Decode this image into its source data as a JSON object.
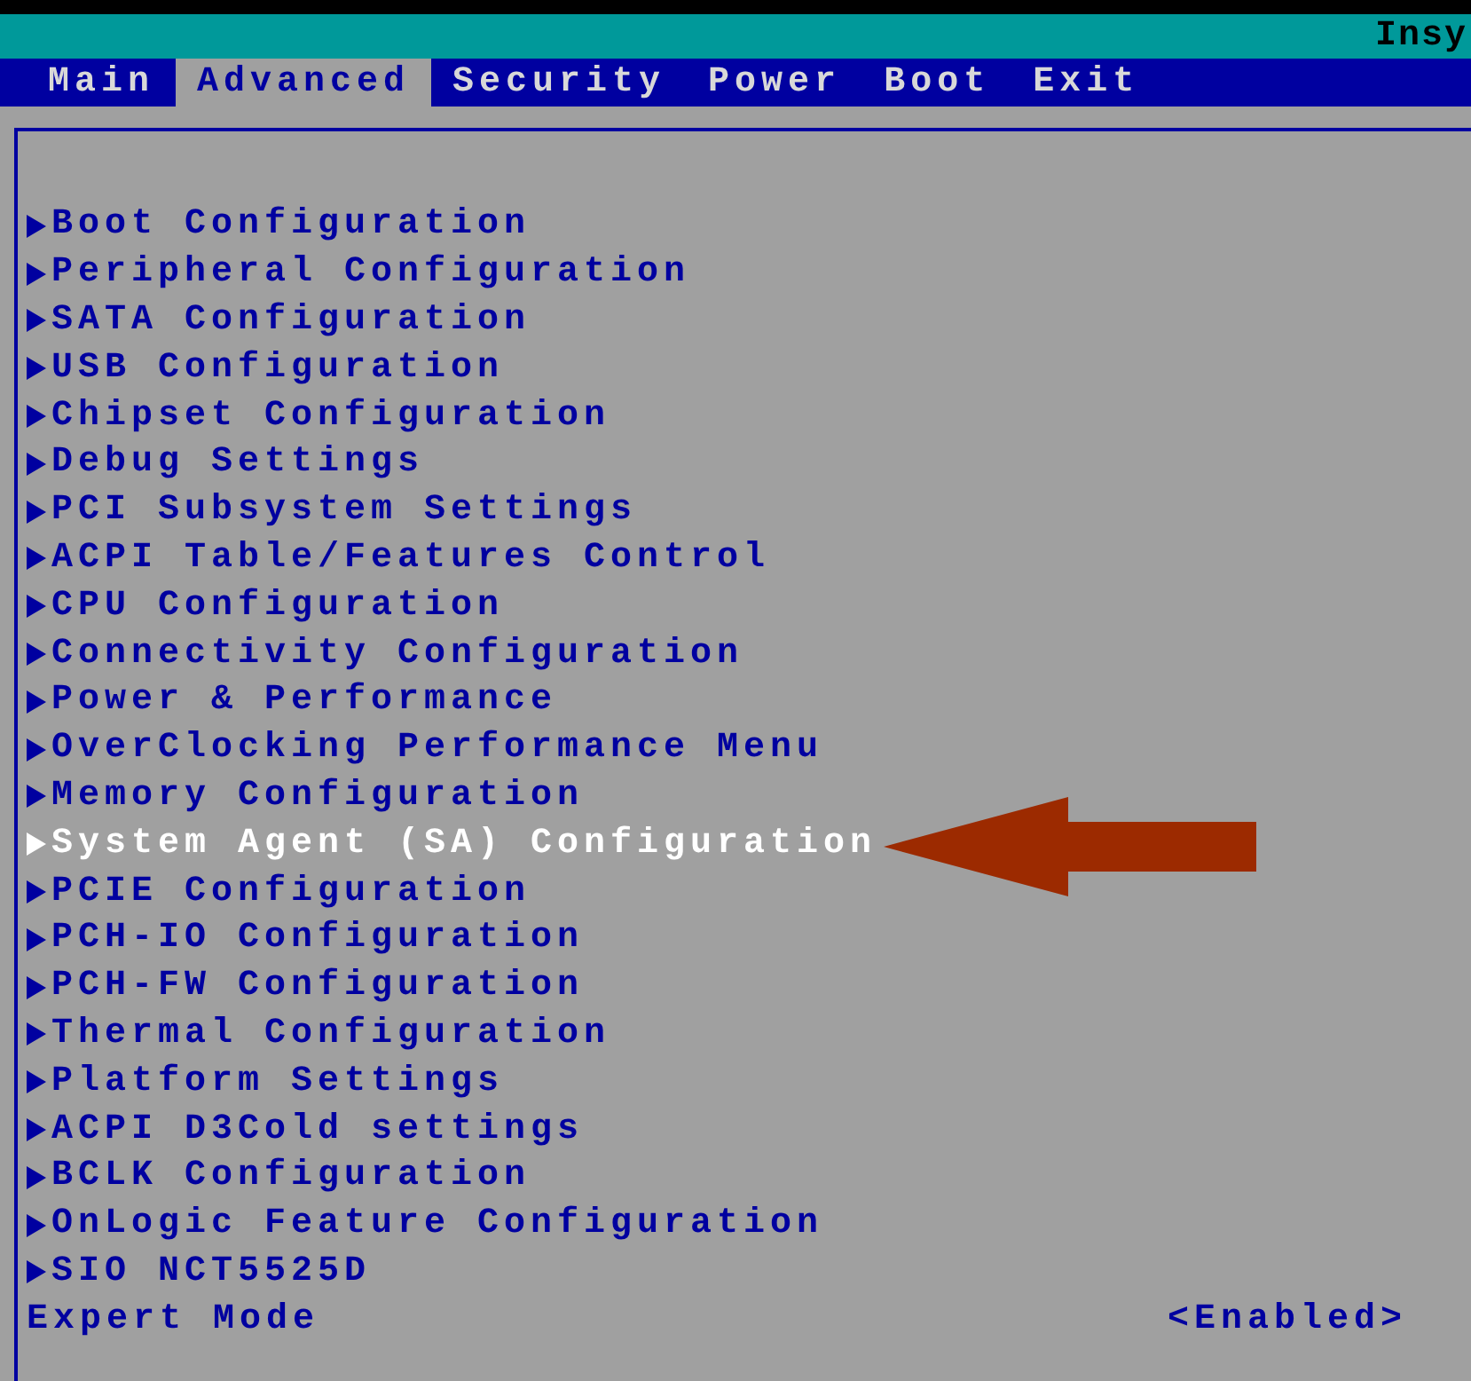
{
  "header": {
    "title": "Insy"
  },
  "tabs": [
    {
      "label": "Main",
      "selected": false
    },
    {
      "label": "Advanced",
      "selected": true
    },
    {
      "label": "Security",
      "selected": false
    },
    {
      "label": "Power",
      "selected": false
    },
    {
      "label": "Boot",
      "selected": false
    },
    {
      "label": "Exit",
      "selected": false
    }
  ],
  "items": [
    {
      "kind": "submenu",
      "label": "Boot Configuration",
      "selected": false
    },
    {
      "kind": "submenu",
      "label": "Peripheral Configuration",
      "selected": false
    },
    {
      "kind": "submenu",
      "label": "SATA Configuration",
      "selected": false
    },
    {
      "kind": "submenu",
      "label": "USB Configuration",
      "selected": false
    },
    {
      "kind": "submenu",
      "label": "Chipset Configuration",
      "selected": false
    },
    {
      "kind": "submenu",
      "label": "Debug Settings",
      "selected": false
    },
    {
      "kind": "submenu",
      "label": "PCI Subsystem Settings",
      "selected": false
    },
    {
      "kind": "submenu",
      "label": "ACPI Table/Features Control",
      "selected": false
    },
    {
      "kind": "submenu",
      "label": "CPU Configuration",
      "selected": false
    },
    {
      "kind": "submenu",
      "label": "Connectivity Configuration",
      "selected": false
    },
    {
      "kind": "submenu",
      "label": "Power & Performance",
      "selected": false
    },
    {
      "kind": "submenu",
      "label": "OverClocking Performance Menu",
      "selected": false
    },
    {
      "kind": "submenu",
      "label": "Memory Configuration",
      "selected": false
    },
    {
      "kind": "submenu",
      "label": "System Agent (SA) Configuration",
      "selected": true
    },
    {
      "kind": "submenu",
      "label": "PCIE Configuration",
      "selected": false
    },
    {
      "kind": "submenu",
      "label": "PCH-IO Configuration",
      "selected": false
    },
    {
      "kind": "submenu",
      "label": "PCH-FW Configuration",
      "selected": false
    },
    {
      "kind": "submenu",
      "label": "Thermal Configuration",
      "selected": false
    },
    {
      "kind": "submenu",
      "label": "Platform Settings",
      "selected": false
    },
    {
      "kind": "submenu",
      "label": "ACPI D3Cold settings",
      "selected": false
    },
    {
      "kind": "submenu",
      "label": "BCLK Configuration",
      "selected": false
    },
    {
      "kind": "submenu",
      "label": "OnLogic Feature Configuration",
      "selected": false
    },
    {
      "kind": "submenu",
      "label": "SIO NCT5525D",
      "selected": false
    },
    {
      "kind": "setting",
      "label": "Expert Mode",
      "value": "<Enabled>",
      "selected": false
    }
  ]
}
